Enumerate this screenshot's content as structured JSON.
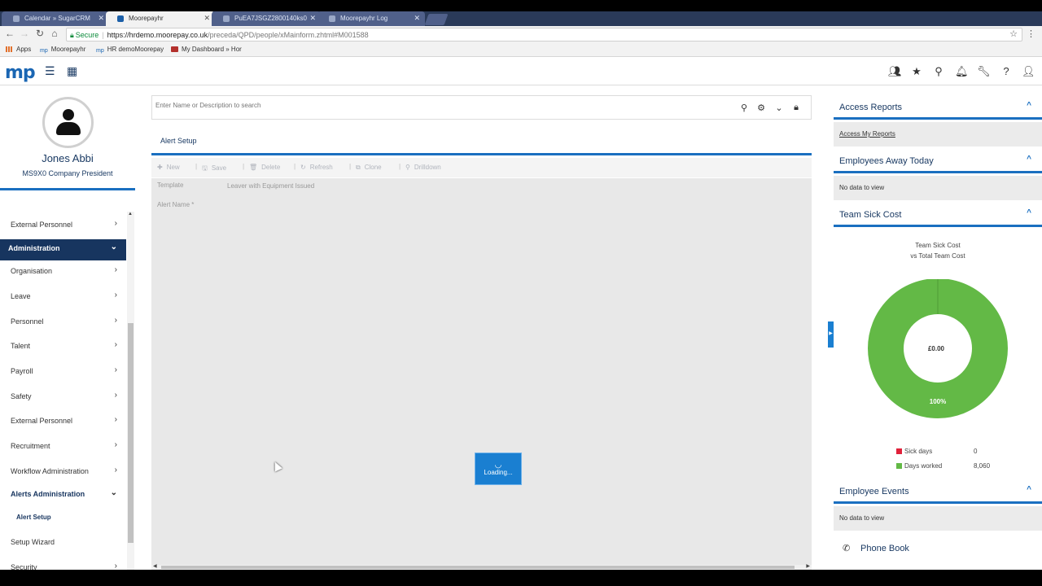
{
  "browser": {
    "tabs": [
      {
        "title": "Calendar » SugarCRM"
      },
      {
        "title": "Moorepayhr"
      },
      {
        "title": "PuEA7JSGZ2800140ks0"
      },
      {
        "title": "Moorepayhr Log"
      }
    ],
    "url": {
      "secure_label": "Secure",
      "host": "https://hrdemo.moorepay.co.uk",
      "path": "/preceda/QPD/people/xMainform.zhtml#M001588"
    },
    "bookmarks": [
      {
        "label": "Apps"
      },
      {
        "label": "Moorepayhr"
      },
      {
        "label": "HR demoMoorepay"
      },
      {
        "label": "My Dashboard » Hor"
      }
    ]
  },
  "header": {
    "logo": "mp"
  },
  "user": {
    "name": "Jones Abbi",
    "role": "MS9X0 Company President"
  },
  "sidebar": {
    "items": [
      {
        "label": "External Personnel"
      },
      {
        "label": "Administration"
      },
      {
        "label": "Organisation"
      },
      {
        "label": "Leave"
      },
      {
        "label": "Personnel"
      },
      {
        "label": "Talent"
      },
      {
        "label": "Payroll"
      },
      {
        "label": "Safety"
      },
      {
        "label": "External Personnel"
      },
      {
        "label": "Recruitment"
      },
      {
        "label": "Workflow Administration"
      },
      {
        "label": "Alerts Administration"
      },
      {
        "label": "Alert Setup"
      },
      {
        "label": "Setup Wizard"
      },
      {
        "label": "Security"
      }
    ]
  },
  "search": {
    "placeholder": "Enter Name or Description to search"
  },
  "panel": {
    "title": "Alert Setup",
    "toolbar": {
      "new": "New",
      "save": "Save",
      "delete": "Delete",
      "refresh": "Refresh",
      "clone": "Clone",
      "drilldown": "Drilldown"
    },
    "form": {
      "template_label": "Template",
      "template_value": "Leaver with Equipment Issued",
      "alert_name_label": "Alert Name *"
    },
    "loading_text": "Loading..."
  },
  "right_panel": {
    "access_reports": {
      "title": "Access Reports",
      "link": "Access My Reports"
    },
    "employees_away": {
      "title": "Employees Away Today",
      "body": "No data to view"
    },
    "team_sick_cost": {
      "title": "Team Sick Cost",
      "chart_title_line1": "Team Sick Cost",
      "chart_title_line2": "vs Total Team Cost",
      "center_label": "£0.00",
      "slice_label": "100%"
    },
    "employee_events": {
      "title": "Employee Events",
      "body": "No data to view"
    },
    "phone_book": {
      "title": "Phone Book"
    }
  },
  "chart_data": {
    "type": "pie",
    "title": "Team Sick Cost vs Total Team Cost",
    "categories": [
      "Sick days",
      "Days worked"
    ],
    "values": [
      0,
      8060
    ],
    "value_labels": [
      "0",
      "8,060"
    ],
    "colors": [
      "#e0213a",
      "#63b946"
    ],
    "center_label": "£0.00",
    "slice_labels": [
      "100%"
    ]
  },
  "colors": {
    "brand": "#1a66b3",
    "accent": "#1a6fc0",
    "nav_active": "#17355f",
    "loading": "#1a7fd1"
  }
}
